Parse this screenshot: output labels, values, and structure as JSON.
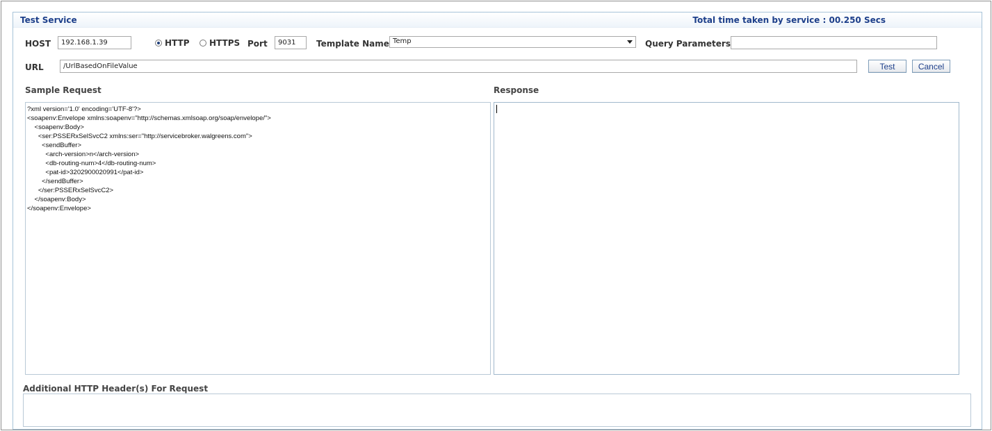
{
  "header": {
    "title": "Test Service",
    "time_taken": "Total time taken by service : 00.250 Secs"
  },
  "form": {
    "host_label": "HOST",
    "host_value": "192.168.1.39",
    "http_label": "HTTP",
    "https_label": "HTTPS",
    "protocol_selected": "HTTP",
    "port_label": "Port",
    "port_value": "9031",
    "template_label": "Template Name",
    "template_value": "Temp",
    "query_label": "Query Parameters",
    "query_value": "",
    "url_label": "URL",
    "url_value": "/UrlBasedOnFileValue"
  },
  "buttons": {
    "test": "Test",
    "cancel": "Cancel"
  },
  "sections": {
    "sample_request": "Sample Request",
    "response": "Response",
    "additional_headers": "Additional HTTP Header(s) For Request"
  },
  "sample_request_lines": [
    "?xml version='1.0' encoding='UTF-8'?>",
    "<soapenv:Envelope xmlns:soapenv=\"http://schemas.xmlsoap.org/soap/envelope/\">",
    "    <soapenv:Body>",
    "      <ser:PSSERxSelSvcC2 xmlns:ser=\"http://servicebroker.walgreens.com\">",
    "        <sendBuffer>",
    "          <arch-version>n</arch-version>",
    "          <db-routing-num>4</db-routing-num>",
    "          <pat-id>3202900020991</pat-id>",
    "        </sendBuffer>",
    "      </ser:PSSERxSelSvcC2>",
    "    </soapenv:Body>",
    "</soapenv:Envelope>"
  ],
  "response_text": ""
}
